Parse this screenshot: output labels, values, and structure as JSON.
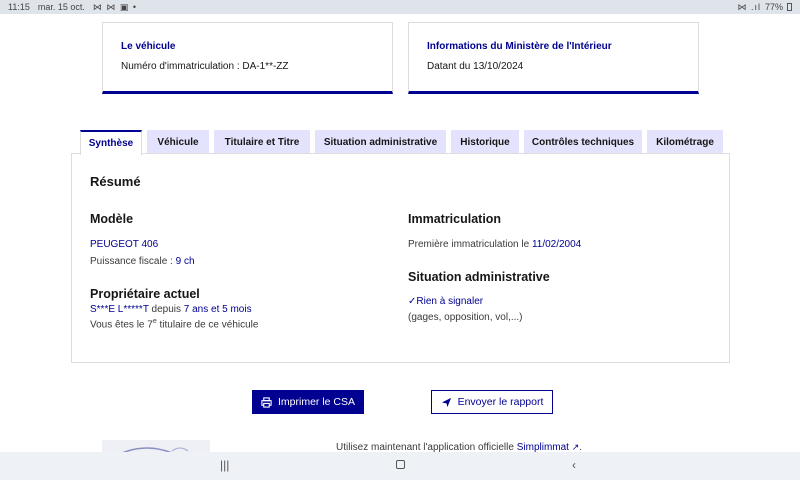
{
  "status_bar": {
    "time": "11:15",
    "date": "mar. 15 oct.",
    "notif_icons": "⋈ ⋈ ▣ •",
    "sys_icons": "⋈ .ıl",
    "battery": "77%"
  },
  "cards": {
    "vehicle": {
      "title": "Le véhicule",
      "text": "Numéro d'immatriculation : DA-1**-ZZ"
    },
    "ministry": {
      "title": "Informations du Ministère de l'Intérieur",
      "text": "Datant du 13/10/2024"
    }
  },
  "tabs": [
    {
      "label": "Synthèse"
    },
    {
      "label": "Véhicule"
    },
    {
      "label": "Titulaire et Titre"
    },
    {
      "label": "Situation administrative"
    },
    {
      "label": "Historique"
    },
    {
      "label": "Contrôles techniques"
    },
    {
      "label": "Kilométrage"
    }
  ],
  "summary": {
    "heading": "Résumé",
    "model": {
      "heading": "Modèle",
      "value": "PEUGEOT 406",
      "power_label": "Puissance fiscale : ",
      "power_value": "9 ch"
    },
    "owner": {
      "heading": "Propriétaire actuel",
      "name": "S***E L*****T",
      "since_label": " depuis ",
      "duration": "7 ans et 5 mois",
      "rank_prefix": "Vous êtes le 7",
      "rank_sup": "e",
      "rank_suffix": " titulaire de ce véhicule"
    },
    "registration": {
      "heading": "Immatriculation",
      "label": "Première immatriculation le ",
      "date": "11/02/2004"
    },
    "admin": {
      "heading": "Situation administrative",
      "status": "Rien à signaler",
      "detail": "(gages, opposition, vol,...)"
    }
  },
  "buttons": {
    "print": "Imprimer le CSA",
    "send": "Envoyer le rapport"
  },
  "footer": {
    "text": "Utilisez maintenant l'application officielle ",
    "link": "Simplimmat",
    "after": "."
  },
  "colors": {
    "accent": "#000091",
    "tab_bg": "#e3e3fd"
  }
}
